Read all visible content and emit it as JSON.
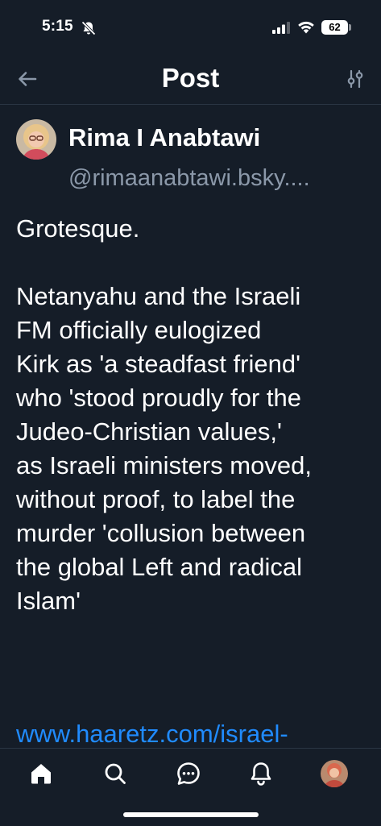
{
  "status_bar": {
    "time": "5:15",
    "battery": "62",
    "icons": [
      "bell-muted-icon",
      "cellular-signal-icon",
      "wifi-icon",
      "battery-icon"
    ]
  },
  "header": {
    "title": "Post",
    "back_icon": "arrow-left-icon",
    "filter_icon": "sliders-icon"
  },
  "post": {
    "author_name": "Rima I Anabtawi",
    "author_handle": "@rimaanabtawi.bsky....",
    "text_intro": "Grotesque.",
    "text_body": "Netanyahu and the Israeli\nFM  officially eulogized\nKirk as 'a steadfast friend'\nwho 'stood proudly for the\nJudeo-Christian values,'\nas Israeli ministers moved,\nwithout proof, to label the\nmurder 'collusion between\nthe global Left and radical\nIslam'",
    "link_text": "www.haaretz.com/israel-"
  },
  "tabbar": {
    "items": [
      "home-icon",
      "search-icon",
      "chat-icon",
      "bell-icon",
      "profile-avatar"
    ]
  },
  "colors": {
    "background": "#151d28",
    "link": "#208bfe",
    "muted": "#8b98a9",
    "divider": "#2b3644"
  }
}
